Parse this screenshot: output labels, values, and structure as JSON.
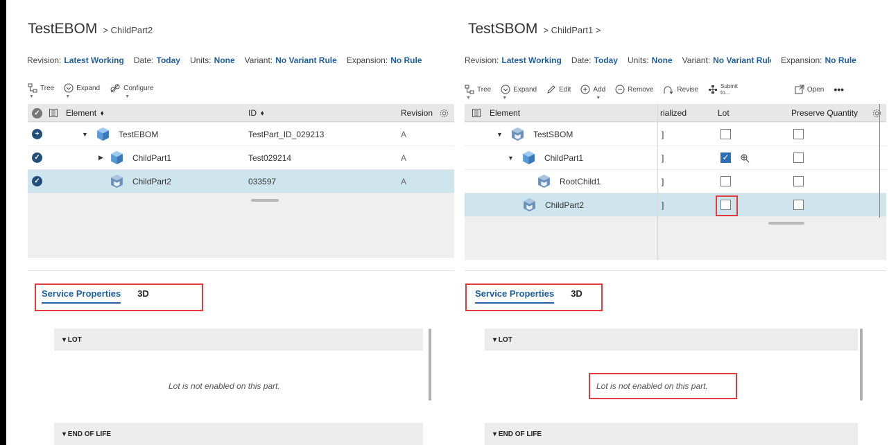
{
  "left": {
    "title": "TestEBOM",
    "breadcrumb": "> ChildPart2",
    "revision": {
      "revision_label": "Revision:",
      "revision_value": "Latest Working",
      "date_label": "Date:",
      "date_value": "Today",
      "units_label": "Units:",
      "units_value": "None",
      "variant_label": "Variant:",
      "variant_value": "No Variant Rule",
      "expansion_label": "Expansion:",
      "expansion_value": "No Rule"
    },
    "toolbar": {
      "tree": "Tree",
      "expand": "Expand",
      "configure": "Configure"
    },
    "columns": {
      "element": "Element",
      "id": "ID",
      "revision": "Revision"
    },
    "sort_glyph": "⬧",
    "rows": [
      {
        "name": "TestEBOM",
        "id": "TestPart_ID_029213",
        "rev": "A",
        "status": "+"
      },
      {
        "name": "ChildPart1",
        "id": "Test029214",
        "rev": "A",
        "status": "✓"
      },
      {
        "name": "ChildPart2",
        "id": "033597",
        "rev": "A",
        "status": "✓"
      }
    ],
    "tabs": {
      "service": "Service Properties",
      "three_d": "3D"
    },
    "sections": {
      "lot": "▾ LOT",
      "eol": "▾ END OF LIFE"
    },
    "lot_message": "Lot is not enabled on this part."
  },
  "right": {
    "title": "TestSBOM",
    "breadcrumb": "> ChildPart1 >",
    "revision": {
      "revision_label": "Revision:",
      "revision_value": "Latest Working",
      "date_label": "Date:",
      "date_value": "Today",
      "units_label": "Units:",
      "units_value": "None",
      "variant_label": "Variant:",
      "variant_value": "No Variant Rule",
      "expansion_label": "Expansion:",
      "expansion_value": "No Rule"
    },
    "toolbar": {
      "tree": "Tree",
      "expand": "Expand",
      "edit": "Edit",
      "add": "Add",
      "remove": "Remove",
      "revise": "Revise",
      "submit_1": "Submit",
      "submit_2": "to...",
      "open": "Open",
      "more": "•••"
    },
    "columns": {
      "element": "Element",
      "serialized": "rialized",
      "lot": "Lot",
      "preserve": "Preserve Quantity"
    },
    "rows": [
      {
        "name": "TestSBOM",
        "lot_checked": false
      },
      {
        "name": "ChildPart1",
        "lot_checked": true
      },
      {
        "name": "RootChild1",
        "lot_checked": false
      },
      {
        "name": "ChildPart2",
        "lot_checked": false
      }
    ],
    "tabs": {
      "service": "Service Properties",
      "three_d": "3D"
    },
    "sections": {
      "lot": "▾ LOT",
      "eol": "▾ END OF LIFE"
    },
    "lot_message": "Lot is not enabled on this part."
  },
  "colors": {
    "accent": "#1f5fa0",
    "highlight": "#e0393e",
    "selected_row": "#cfe5ee"
  }
}
